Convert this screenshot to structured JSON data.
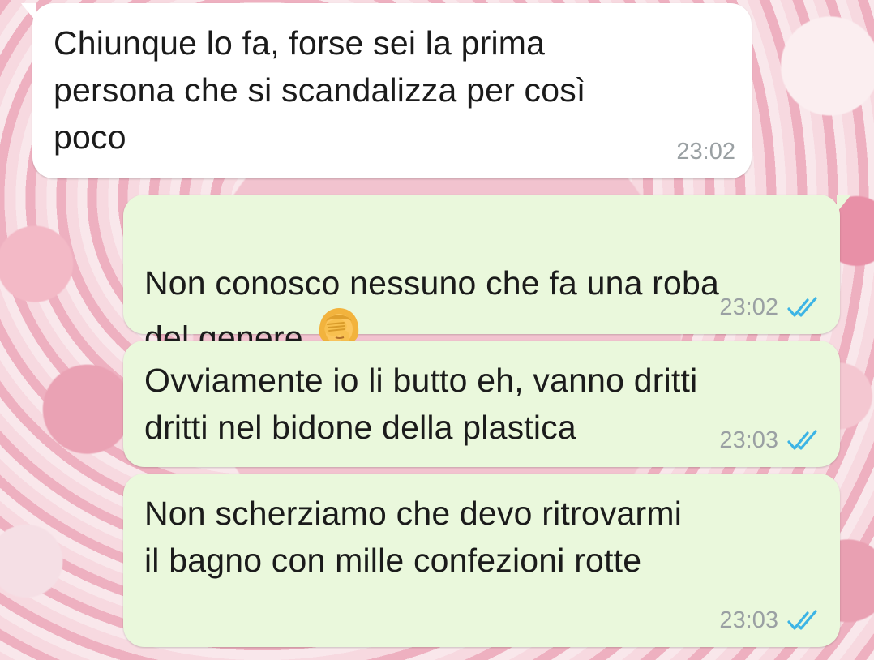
{
  "colors": {
    "incoming_bubble": "#ffffff",
    "outgoing_bubble": "#eaf8dc",
    "time_text": "#9aa0a3",
    "read_ticks": "#3cb4e5"
  },
  "messages": [
    {
      "direction": "incoming",
      "text": "Chiunque lo fa, forse sei la prima\npersona che si scandalizza per così\npoco",
      "time": "23:02"
    },
    {
      "direction": "outgoing",
      "text": "Non conosco nessuno che fa una roba\ndel genere",
      "emoji": "woman-facepalming-icon",
      "time": "23:02",
      "status": "read"
    },
    {
      "direction": "outgoing",
      "text": "Ovviamente io li butto eh, vanno dritti\ndritti nel bidone della plastica",
      "time": "23:03",
      "status": "read"
    },
    {
      "direction": "outgoing",
      "text": "Non scherziamo che devo ritrovarmi\nil bagno con mille confezioni rotte",
      "time": "23:03",
      "status": "read"
    }
  ]
}
